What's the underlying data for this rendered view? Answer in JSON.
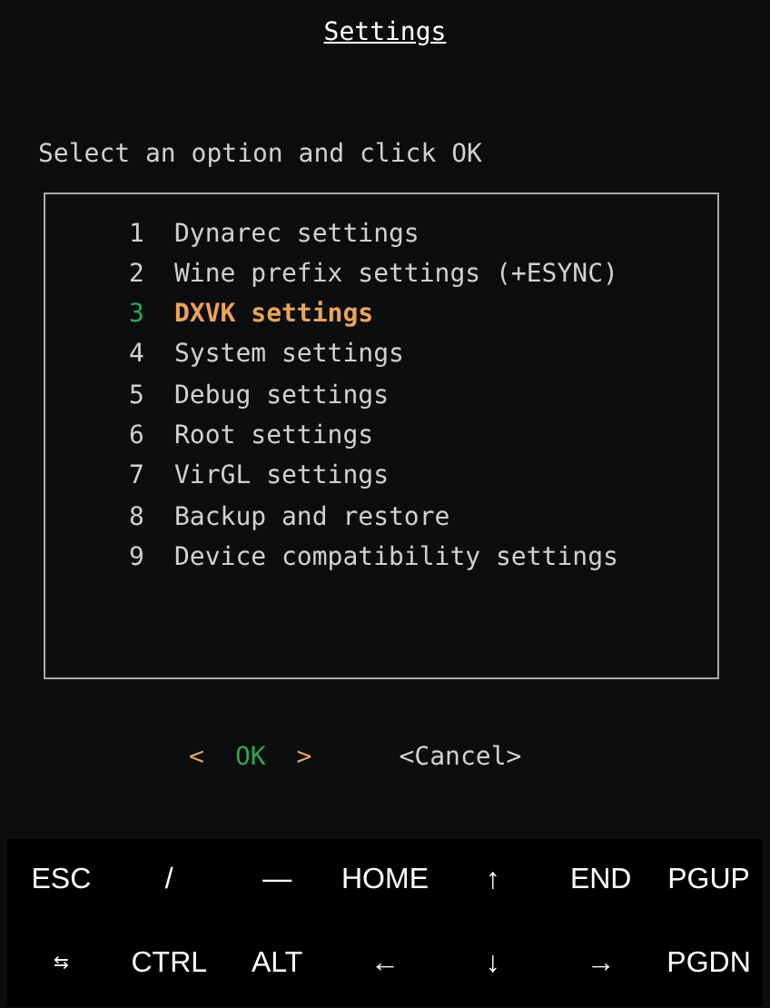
{
  "title": "Settings",
  "prompt": "Select an option and click OK",
  "menu": [
    {
      "number": "1",
      "label": "Dynarec settings",
      "selected": false
    },
    {
      "number": "2",
      "label": "Wine prefix settings (+ESYNC)",
      "selected": false
    },
    {
      "number": "3",
      "label": "DXVK settings",
      "selected": true
    },
    {
      "number": "4",
      "label": "System settings",
      "selected": false
    },
    {
      "number": "5",
      "label": "Debug settings",
      "selected": false
    },
    {
      "number": "6",
      "label": "Root settings",
      "selected": false
    },
    {
      "number": "7",
      "label": "VirGL settings",
      "selected": false
    },
    {
      "number": "8",
      "label": "Backup and restore",
      "selected": false
    },
    {
      "number": "9",
      "label": "Device compatibility settings",
      "selected": false
    }
  ],
  "buttons": [
    {
      "open": "<",
      "label": "OK",
      "close": ">",
      "selected": true
    },
    {
      "open": "<",
      "label": "Cancel",
      "close": ">",
      "selected": false
    }
  ],
  "keyboard": [
    [
      "ESC",
      "/",
      "—",
      "HOME",
      "↑",
      "END",
      "PGUP"
    ],
    [
      "⇆",
      "CTRL",
      "ALT",
      "←",
      "↓",
      "→",
      "PGDN"
    ]
  ]
}
